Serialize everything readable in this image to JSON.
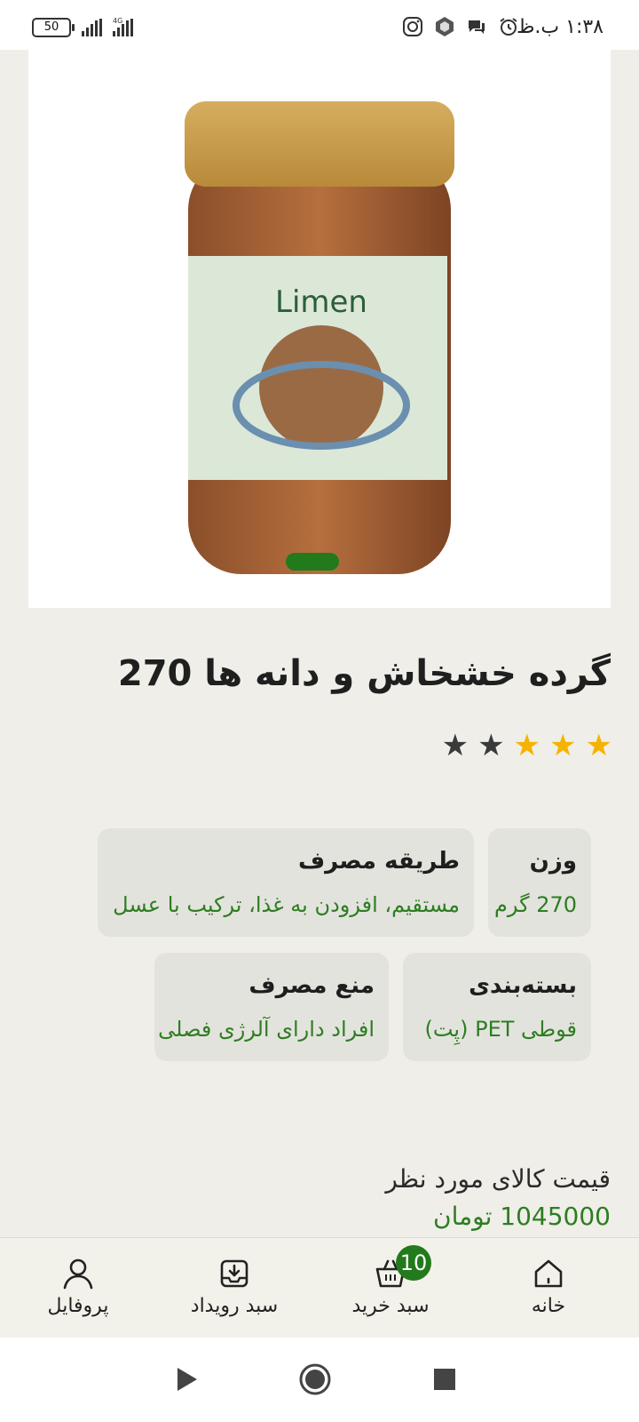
{
  "status_bar": {
    "time": "۱:۳۸ ب.ظ",
    "battery": "50",
    "network": "4G",
    "icons": [
      "instagram-icon",
      "app-icon",
      "chat-icon",
      "alarm-icon"
    ]
  },
  "product": {
    "image_alt": "Limen",
    "title": "گرده خشخاش و دانه ها 270",
    "rating": {
      "value": 3,
      "max": 5
    },
    "colors": {
      "accent": "#227a1c",
      "value_text": "#2e7d22",
      "star_on": "#f5b301",
      "star_off": "#3a3a3a"
    }
  },
  "attributes": [
    {
      "title": "وزن",
      "value": "270 گرم"
    },
    {
      "title": "طریقه مصرف",
      "value": "مستقیم، افزودن به غذا، ترکیب با عسل"
    },
    {
      "title": "بسته‌بندی",
      "value": "قوطی PET (پِت)"
    },
    {
      "title": "منع مصرف",
      "value": "افراد دارای آلرژی فصلی"
    }
  ],
  "price": {
    "label": "قیمت کالای مورد نظر",
    "value": "1045000 تومان"
  },
  "bottom_nav": {
    "items": [
      {
        "label": "خانه",
        "icon": "home-icon"
      },
      {
        "label": "سبد خرید",
        "icon": "basket-icon",
        "badge": "10"
      },
      {
        "label": "سبد رویداد",
        "icon": "inbox-download-icon"
      },
      {
        "label": "پروفایل",
        "icon": "user-icon"
      }
    ]
  },
  "system_nav": [
    "back-icon",
    "home-circle-icon",
    "recents-icon"
  ]
}
